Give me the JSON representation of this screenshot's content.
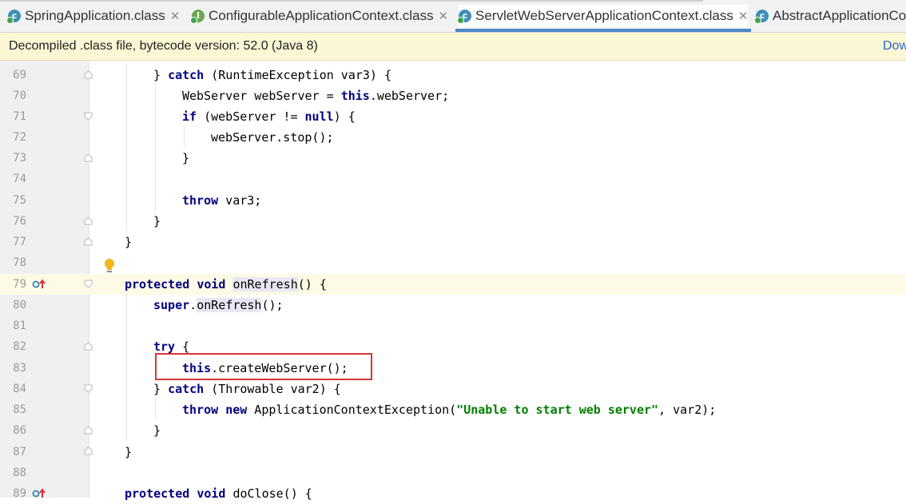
{
  "tabs": [
    {
      "label": "SpringApplication.class",
      "icon": "class-icon",
      "active": false
    },
    {
      "label": "ConfigurableApplicationContext.class",
      "icon": "interface-icon",
      "active": false
    },
    {
      "label": "ServletWebServerApplicationContext.class",
      "icon": "class-icon",
      "active": true
    },
    {
      "label": "AbstractApplicationCo",
      "icon": "class-icon",
      "active": false
    }
  ],
  "banner": {
    "message": "Decompiled .class file, bytecode version: 52.0 (Java 8)",
    "link": "Dow"
  },
  "lines": [
    {
      "num": "69"
    },
    {
      "num": "70"
    },
    {
      "num": "71"
    },
    {
      "num": "72"
    },
    {
      "num": "73"
    },
    {
      "num": "74"
    },
    {
      "num": "75"
    },
    {
      "num": "76"
    },
    {
      "num": "77"
    },
    {
      "num": "78"
    },
    {
      "num": "79"
    },
    {
      "num": "80"
    },
    {
      "num": "81"
    },
    {
      "num": "82"
    },
    {
      "num": "83"
    },
    {
      "num": "84"
    },
    {
      "num": "85"
    },
    {
      "num": "86"
    },
    {
      "num": "87"
    },
    {
      "num": "88"
    },
    {
      "num": "89"
    }
  ],
  "code": {
    "l69": {
      "brace": "} ",
      "kw": "catch",
      "rest": " (RuntimeException var3) {"
    },
    "l70": {
      "pre": "WebServer webServer = ",
      "kw": "this",
      "rest": ".webServer;"
    },
    "l71": {
      "kw": "if",
      "mid": " (webServer != ",
      "kw2": "null",
      "rest": ") {"
    },
    "l72": {
      "text": "webServer.stop();"
    },
    "l73": {
      "text": "}"
    },
    "l75": {
      "kw": "throw",
      "rest": " var3;"
    },
    "l76": {
      "text": "}"
    },
    "l77": {
      "text": "}"
    },
    "l79": {
      "kw": "protected",
      "sp": " ",
      "kw2": "void",
      "sp2": " ",
      "name": "onRefresh",
      "rest": "() {"
    },
    "l80": {
      "kw": "super",
      "dot": ".",
      "name": "onRefresh",
      "rest": "();"
    },
    "l82": {
      "kw": "try",
      "rest": " {"
    },
    "l83": {
      "kw": "this",
      "rest": ".createWebServer();"
    },
    "l84": {
      "brace": "} ",
      "kw": "catch",
      "rest": " (Throwable var2) {"
    },
    "l85": {
      "kw": "throw",
      "sp": " ",
      "kw2": "new",
      "mid": " ApplicationContextException(",
      "str": "\"Unable to start web server\"",
      "rest": ", var2);"
    },
    "l86": {
      "text": "}"
    },
    "l87": {
      "text": "}"
    },
    "l89": {
      "kw": "protected",
      "sp": " ",
      "kw2": "void",
      "rest": " doClose() {"
    }
  },
  "colors": {
    "keyword": "#000080",
    "string": "#008000",
    "highlight_box": "#d8343b",
    "banner": "#fbf6d4",
    "active_tab_underline": "#4a88c7"
  }
}
